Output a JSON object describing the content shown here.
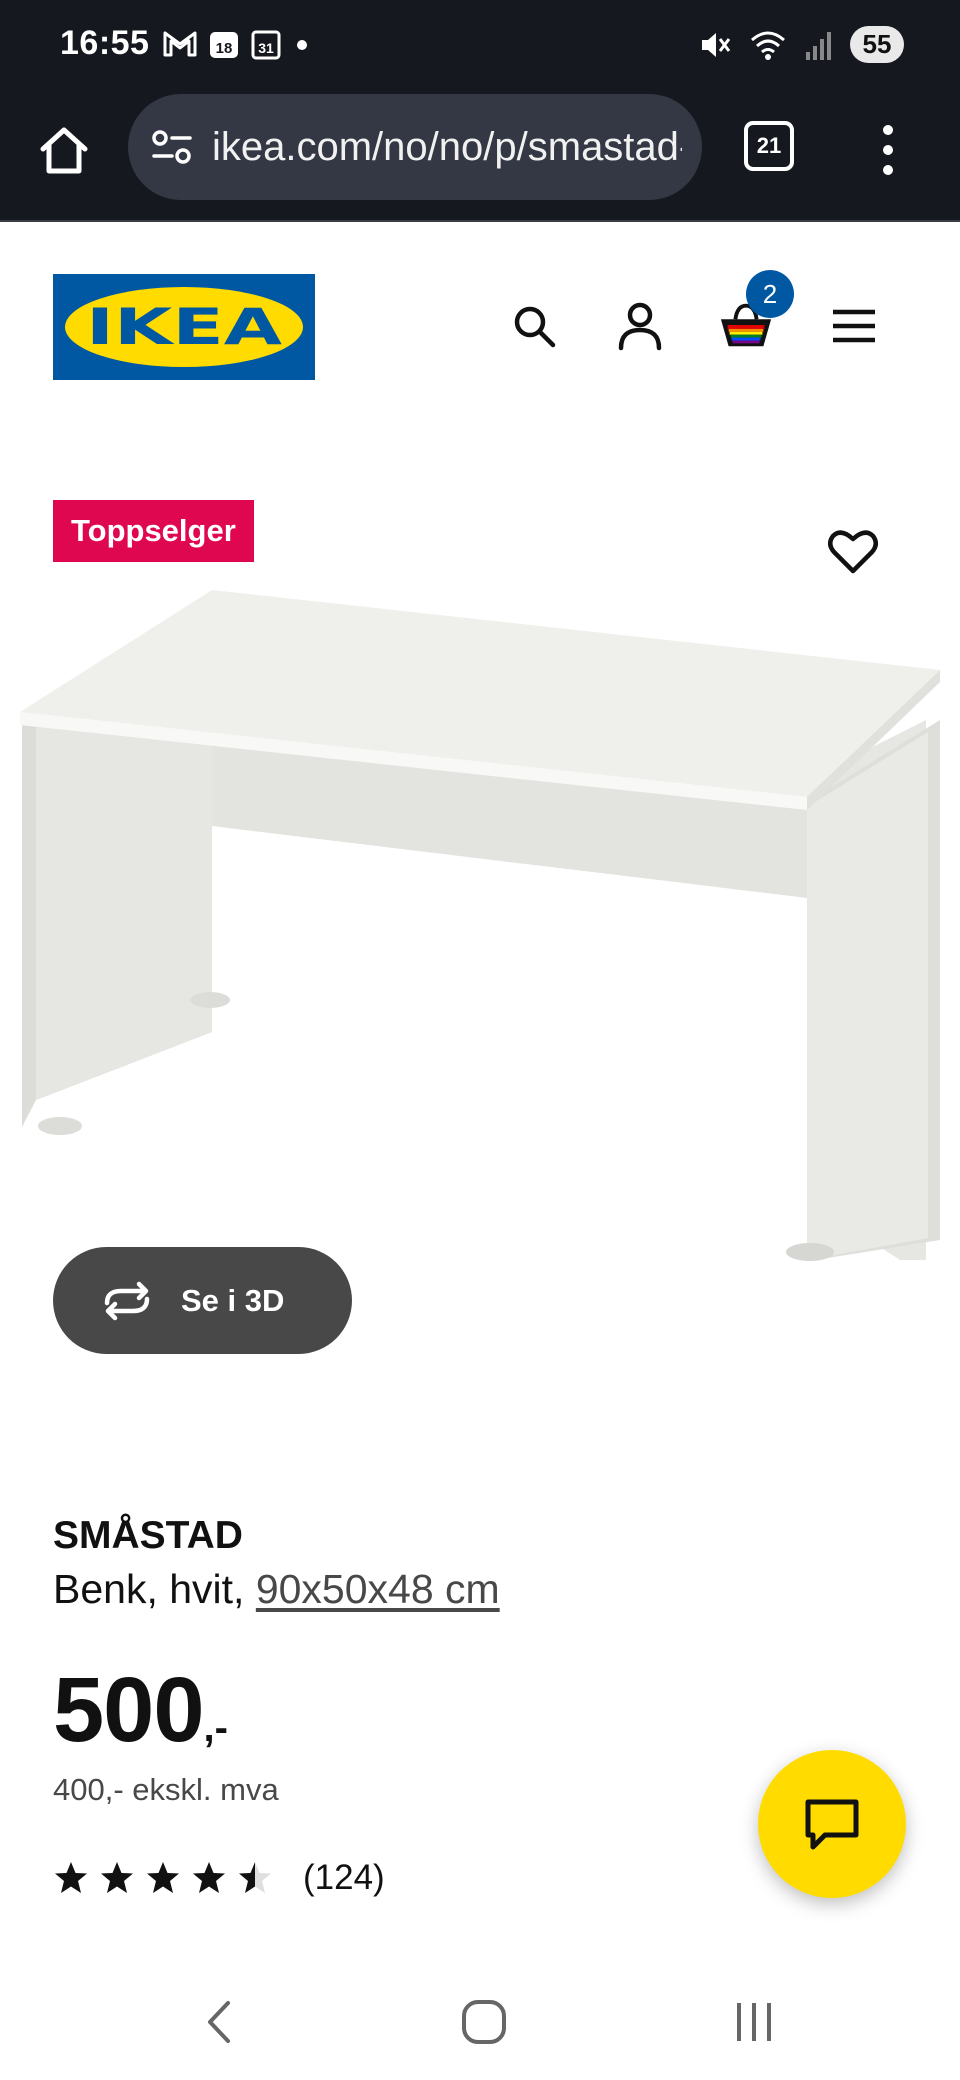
{
  "status_bar": {
    "time": "16:55",
    "date_badge_1": "18",
    "date_badge_2": "31",
    "battery": "55"
  },
  "browser": {
    "url": "ikea.com/no/no/p/smastad-benk-hvit",
    "tab_count": "21"
  },
  "header": {
    "logo_text": "IKEA",
    "cart_count": "2"
  },
  "product": {
    "badge": "Toppselger",
    "view_3d_label": "Se i 3D",
    "name": "SMÅSTAD",
    "description_prefix": "Benk, hvit, ",
    "dimensions": "90x50x48 cm",
    "price_integer": "500",
    "price_suffix": ",-",
    "price_ex_vat": "400,- ekskl. mva",
    "rating_value": 4.5,
    "rating_max": 5,
    "review_count": "(124)"
  },
  "colors": {
    "ikea_blue": "#0058a3",
    "ikea_yellow": "#ffdb00",
    "badge_red": "#e00751",
    "chrome_dark": "#16181f"
  }
}
